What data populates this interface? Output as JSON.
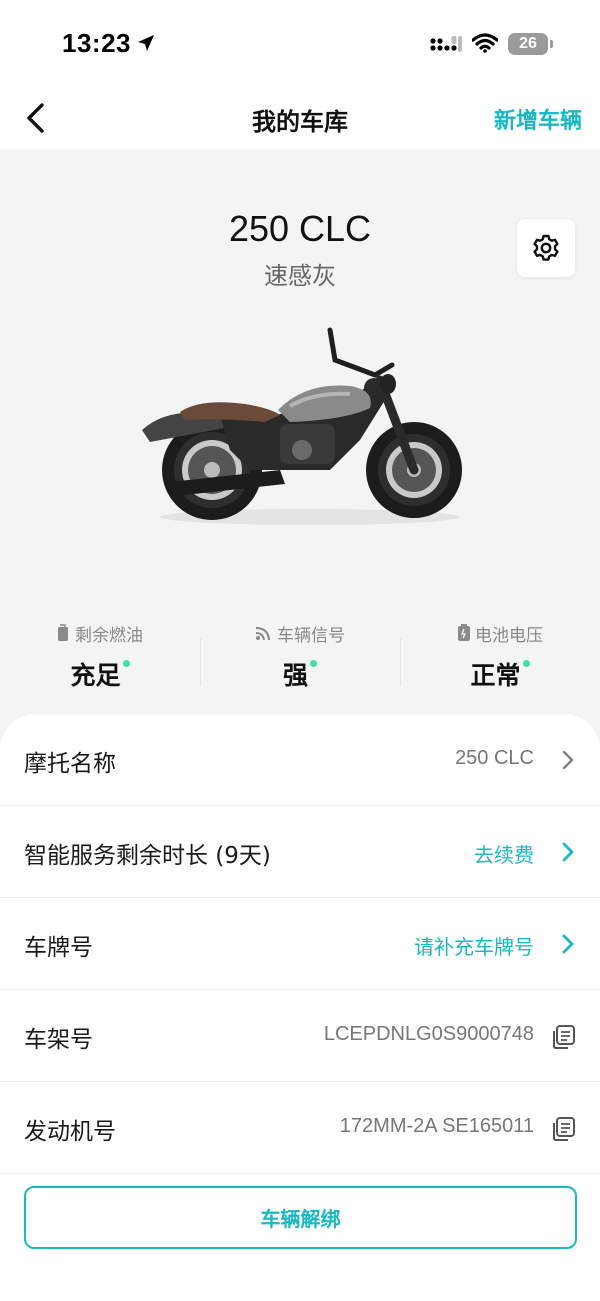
{
  "status_bar": {
    "time": "13:23",
    "battery": "26",
    "icons": [
      "location-arrow-icon",
      "cellular-signal-icon",
      "wifi-icon",
      "battery-icon"
    ]
  },
  "nav": {
    "title": "我的车库",
    "action": "新增车辆",
    "back_icon": "chevron-left-icon"
  },
  "hero": {
    "model_name": "250 CLC",
    "model_color": "速感灰",
    "settings_icon": "gear-icon",
    "image": "motorcycle-image"
  },
  "stats": [
    {
      "label": "剩余燃油",
      "value": "充足",
      "icon": "fuel-icon"
    },
    {
      "label": "车辆信号",
      "value": "强",
      "icon": "signal-icon"
    },
    {
      "label": "电池电压",
      "value": "正常",
      "icon": "battery-icon"
    }
  ],
  "colors": {
    "accent": "#19b8c3",
    "status_ok": "#3fe0a6",
    "hero_bg": "#f4f4f4"
  },
  "info_rows": [
    {
      "label": "摩托名称",
      "value": "250 CLC",
      "icon": "chevron-right-icon"
    },
    {
      "label": "智能服务剩余时长 (9天)",
      "value": "去续费",
      "icon": "chevron-right-icon"
    },
    {
      "label": "车牌号",
      "value": "请补充车牌号",
      "icon": "chevron-right-icon"
    },
    {
      "label": "车架号",
      "value": "LCEPDNLG0S9000748",
      "icon": "copy-icon"
    },
    {
      "label": "发动机号",
      "value": "172MM-2A SE165011",
      "icon": "copy-icon"
    }
  ],
  "unbind_button": "车辆解绑"
}
